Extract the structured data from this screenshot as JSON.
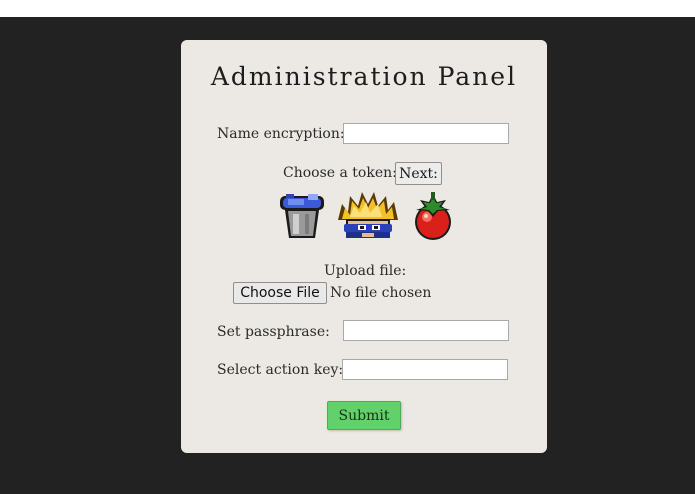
{
  "panel": {
    "title": "Administration Panel"
  },
  "form": {
    "name_encryption_label": "Name encryption:",
    "name_encryption_value": "",
    "token_label": "Choose a token:",
    "next_label": "Next:",
    "tokens": [
      "bucket-icon",
      "spiky-hair-ninja-icon",
      "tomato-icon"
    ],
    "upload_label": "Upload file:",
    "choose_file_label": "Choose File",
    "no_file_text": "No file chosen",
    "passphrase_label": "Set passphrase:",
    "passphrase_value": "",
    "action_key_label": "Select action key:",
    "action_key_value": "",
    "submit_label": "Submit"
  },
  "colors": {
    "page_background": "#222222",
    "panel_background": "#ece9e4",
    "submit_button": "#63d16b"
  }
}
